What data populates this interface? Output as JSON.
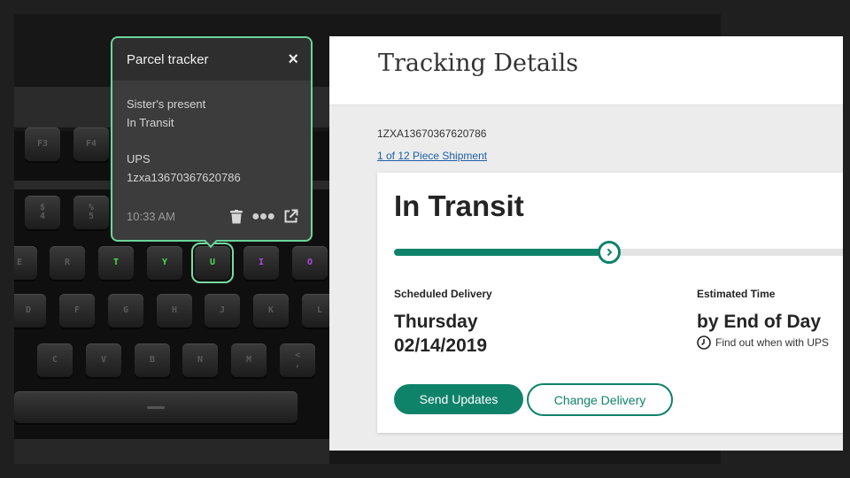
{
  "popup": {
    "title": "Parcel tracker",
    "close": "×",
    "note": "Sister's present",
    "status": "In Transit",
    "carrier": "UPS",
    "tracking": "1zxa13670367620786",
    "time": "10:33 AM",
    "accent_color": "#6bd49c"
  },
  "keyboard": {
    "row_f": [
      "F3",
      "F4"
    ],
    "row_num": [
      "$\n4",
      "%\n5"
    ],
    "row_q": [
      "E",
      "R",
      "T",
      "Y",
      "U",
      "I",
      "O"
    ],
    "row_a": [
      "D",
      "F",
      "G",
      "H",
      "J",
      "K",
      "L"
    ],
    "row_z": [
      "C",
      "V",
      "B",
      "N",
      "M",
      "<\n,"
    ]
  },
  "page": {
    "title": "Tracking Details",
    "tracking_number": "1ZXA13670367620786",
    "piece_link": "1 of 12 Piece Shipment",
    "status": "In Transit",
    "progress": 0.45,
    "scheduled_label": "Scheduled Delivery",
    "scheduled_day": "Thursday",
    "scheduled_date": "02/14/2019",
    "estimated_label": "Estimated Time",
    "estimated_value": "by End of Day",
    "ups_hint": "Find out when with UPS",
    "send_updates": "Send Updates",
    "change_delivery": "Change Delivery",
    "brand_color": "#0f826a"
  }
}
